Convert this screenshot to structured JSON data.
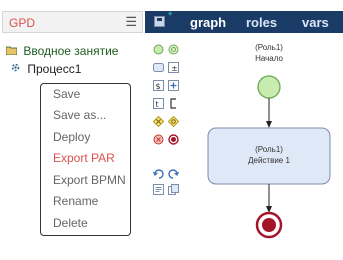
{
  "left_panel": {
    "title": "GPD",
    "menu_icon": "hamburger-icon",
    "tree": [
      {
        "label": "Вводное занятие",
        "icon": "folder-icon"
      },
      {
        "label": "Процесс1",
        "icon": "process-icon"
      }
    ],
    "context_menu": [
      {
        "label": "Save",
        "active": false
      },
      {
        "label": "Save as...",
        "active": false
      },
      {
        "label": "Deploy",
        "active": false
      },
      {
        "label": "Export PAR",
        "active": true
      },
      {
        "label": "Export BPMN",
        "active": false
      },
      {
        "label": "Rename",
        "active": false
      },
      {
        "label": "Delete",
        "active": false
      }
    ]
  },
  "editor": {
    "dirty_mark": "*",
    "tabs": [
      {
        "label": "graph",
        "active": true
      },
      {
        "label": "roles",
        "active": false
      },
      {
        "label": "vars",
        "active": false
      }
    ]
  },
  "palette": [
    "start-event-icon",
    "start-event-alt-icon",
    "task-icon",
    "subprocess-icon",
    "script-task-icon",
    "add-icon",
    "timer-icon",
    "bracket-icon",
    "gateway-icon",
    "gateway-alt-icon",
    "cancel-event-icon",
    "end-event-icon",
    "undo-icon",
    "redo-icon",
    "text-annotation-icon",
    "copy-icon"
  ],
  "diagram": {
    "start": {
      "role": "(Роль1)",
      "name": "Начало"
    },
    "task": {
      "role": "(Роль1)",
      "name": "Действие 1"
    }
  },
  "colors": {
    "header_bg": "#1a3b66",
    "active_item": "#d9534f",
    "start_fill": "#c8ebb0",
    "task_fill": "#dfe8f6",
    "end_fill": "#a5152a"
  }
}
